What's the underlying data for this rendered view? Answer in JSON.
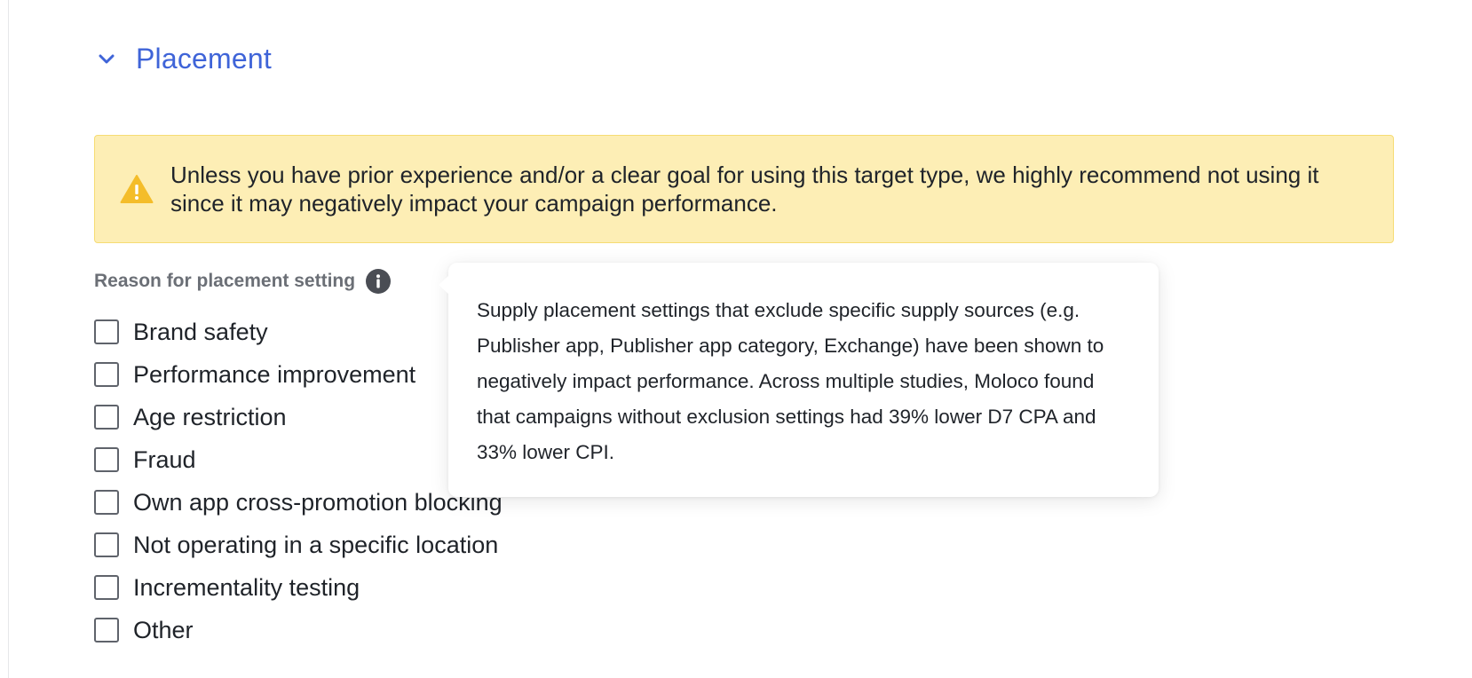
{
  "section": {
    "title": "Placement",
    "expanded": true,
    "icon": "chevron-down-icon"
  },
  "banner": {
    "icon": "warning-icon",
    "text": "Unless you have prior experience and/or a clear goal for using this target type, we highly recommend not using it since it may negatively impact your campaign performance.",
    "background": "#fdeeb5",
    "icon_color": "#f4bd2a"
  },
  "reason": {
    "label": "Reason for placement setting",
    "info_icon": "info-icon",
    "options": [
      {
        "label": "Brand safety",
        "checked": false
      },
      {
        "label": "Performance improvement",
        "checked": false
      },
      {
        "label": "Age restriction",
        "checked": false
      },
      {
        "label": "Fraud",
        "checked": false
      },
      {
        "label": "Own app cross-promotion blocking",
        "checked": false
      },
      {
        "label": "Not operating in a specific location",
        "checked": false
      },
      {
        "label": "Incrementality testing",
        "checked": false
      },
      {
        "label": "Other",
        "checked": false
      }
    ]
  },
  "tooltip": {
    "text": "Supply placement settings that exclude specific supply sources (e.g. Publisher app, Publisher app category, Exchange) have been shown to negatively impact performance. Across multiple studies, Moloco found that campaigns without exclusion settings had 39% lower D7 CPA and 33% lower CPI."
  },
  "colors": {
    "accent": "#3f64d8",
    "label_gray": "#6b6f76"
  }
}
